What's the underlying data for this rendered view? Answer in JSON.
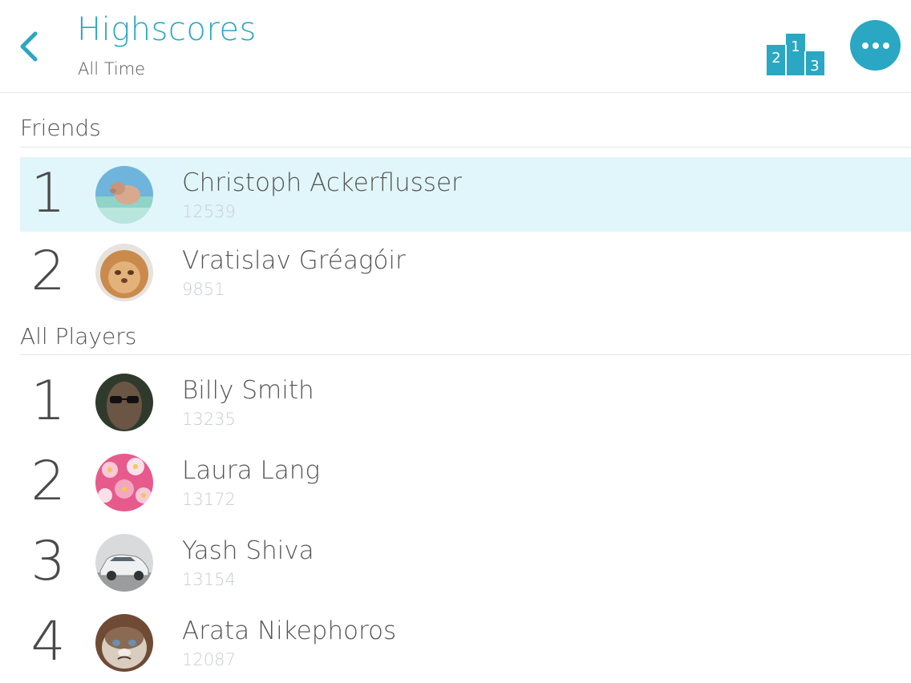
{
  "header": {
    "title": "Highscores",
    "subtitle": "All Time",
    "podium": {
      "first": "1",
      "second": "2",
      "third": "3"
    },
    "accent_color": "#2aa7c2"
  },
  "sections": {
    "friends": {
      "label": "Friends",
      "rows": [
        {
          "rank": "1",
          "name": "Christoph Ackerflusser",
          "score": "12539",
          "avatar_icon": "pig-avatar"
        },
        {
          "rank": "2",
          "name": "Vratislav Gréagóir",
          "score": "9851",
          "avatar_icon": "cat-avatar"
        }
      ]
    },
    "all_players": {
      "label": "All Players",
      "rows": [
        {
          "rank": "1",
          "name": "Billy Smith",
          "score": "13235",
          "avatar_icon": "man-sunglasses-avatar"
        },
        {
          "rank": "2",
          "name": "Laura Lang",
          "score": "13172",
          "avatar_icon": "flowers-avatar"
        },
        {
          "rank": "3",
          "name": "Yash Shiva",
          "score": "13154",
          "avatar_icon": "car-avatar"
        },
        {
          "rank": "4",
          "name": "Arata Nikephoros",
          "score": "12087",
          "avatar_icon": "grumpy-cat-avatar"
        }
      ]
    }
  },
  "highlight_color": "#e1f6fb"
}
